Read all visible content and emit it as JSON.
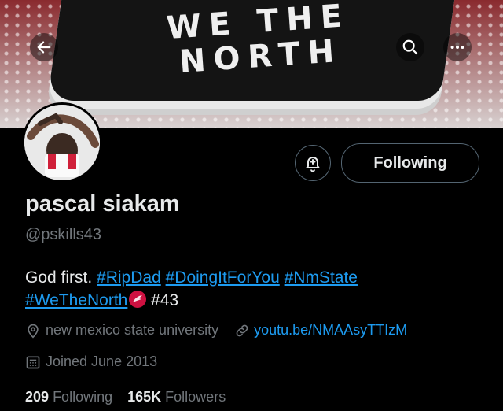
{
  "banner": {
    "flag_line1": "WE THE",
    "flag_line2": "NORTH"
  },
  "profile": {
    "name": "pascal siakam",
    "handle": "@pskills43",
    "following_label": "Following",
    "bio": {
      "text1": "God first. ",
      "tag1": "#RipDad",
      "tag2": "#DoingItForYou",
      "tag3": "#NmState",
      "tag4": "#WeTheNorth",
      "text2": " #43"
    },
    "location": "new mexico state university",
    "website": "youtu.be/NMAAsyTTIzM",
    "joined": "Joined June 2013",
    "following_count": "209",
    "following_text": "Following",
    "followers_count": "165K",
    "followers_text": "Followers"
  },
  "colors": {
    "accent": "#1d9bf0",
    "muted": "#71767b",
    "text": "#e7e9ea",
    "raptors_red": "#ce1141"
  }
}
